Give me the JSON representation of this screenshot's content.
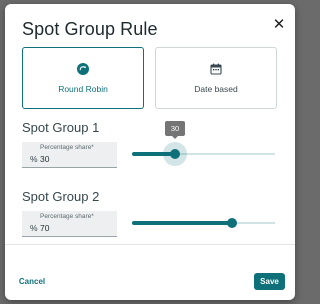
{
  "dialog": {
    "title": "Spot Group Rule",
    "close_icon": "close-icon"
  },
  "options": [
    {
      "label": "Round Robin",
      "icon": "round-robin-icon",
      "selected": true
    },
    {
      "label": "Date based",
      "icon": "calendar-icon",
      "selected": false
    }
  ],
  "groups": [
    {
      "title": "Spot Group 1",
      "field_label": "Percentage share*",
      "prefix": "%",
      "value": "30",
      "slider_value": 30,
      "slider_min": 0,
      "slider_max": 100,
      "tooltip": "30"
    },
    {
      "title": "Spot Group 2",
      "field_label": "Percentage share*",
      "prefix": "%",
      "value": "70",
      "slider_value": 70,
      "slider_min": 0,
      "slider_max": 100
    }
  ],
  "actions": {
    "cancel_label": "Cancel",
    "save_label": "Save"
  },
  "colors": {
    "accent": "#0e7079",
    "tooltip_bg": "#757575"
  }
}
